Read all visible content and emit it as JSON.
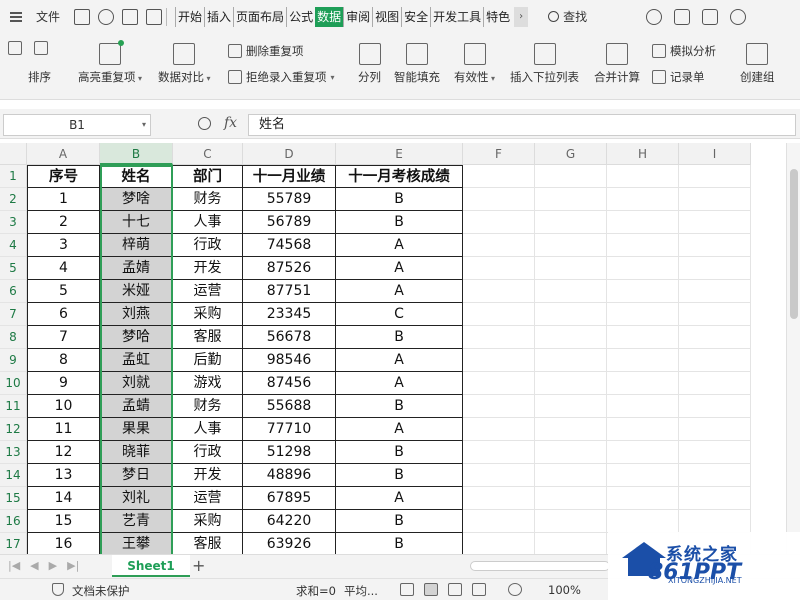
{
  "menubar": {
    "file_label": "文件",
    "tabs": [
      "开始",
      "插入",
      "页面布局",
      "公式",
      "数据",
      "审阅",
      "视图",
      "安全",
      "开发工具",
      "特色"
    ],
    "active_tab": "数据",
    "search_label": "查找"
  },
  "ribbon": {
    "sort": "排序",
    "highlight_dup": "高亮重复项",
    "data_compare": "数据对比",
    "remove_dup": "删除重复项",
    "reject_dup": "拒绝录入重复项",
    "split": "分列",
    "smart_fill": "智能填充",
    "validity": "有效性",
    "insert_dropdown": "插入下拉列表",
    "merge_calc": "合并计算",
    "simulate": "模拟分析",
    "record": "记录单",
    "create_group": "创建组"
  },
  "formula": {
    "cell_ref": "B1",
    "fx": "fx",
    "content": "姓名"
  },
  "grid": {
    "columns": [
      "A",
      "B",
      "C",
      "D",
      "E",
      "F",
      "G",
      "H",
      "I"
    ],
    "row_numbers": [
      "1",
      "2",
      "3",
      "4",
      "5",
      "6",
      "7",
      "8",
      "9",
      "10",
      "11",
      "12",
      "13",
      "14",
      "15",
      "16",
      "17"
    ],
    "header": [
      "序号",
      "姓名",
      "部门",
      "十一月业绩",
      "十一月考核成绩"
    ],
    "rows": [
      [
        "1",
        "梦啥",
        "财务",
        "55789",
        "B"
      ],
      [
        "2",
        "十七",
        "人事",
        "56789",
        "B"
      ],
      [
        "3",
        "梓萌",
        "行政",
        "74568",
        "A"
      ],
      [
        "4",
        "孟婧",
        "开发",
        "87526",
        "A"
      ],
      [
        "5",
        "米娅",
        "运营",
        "87751",
        "A"
      ],
      [
        "6",
        "刘燕",
        "采购",
        "23345",
        "C"
      ],
      [
        "7",
        "梦哈",
        "客服",
        "56678",
        "B"
      ],
      [
        "8",
        "孟虹",
        "后勤",
        "98546",
        "A"
      ],
      [
        "9",
        "刘就",
        "游戏",
        "87456",
        "A"
      ],
      [
        "10",
        "孟蜻",
        "财务",
        "55688",
        "B"
      ],
      [
        "11",
        "果果",
        "人事",
        "77710",
        "A"
      ],
      [
        "12",
        "晓菲",
        "行政",
        "51298",
        "B"
      ],
      [
        "13",
        "梦日",
        "开发",
        "48896",
        "B"
      ],
      [
        "14",
        "刘礼",
        "运营",
        "67895",
        "A"
      ],
      [
        "15",
        "艺青",
        "采购",
        "64220",
        "B"
      ],
      [
        "16",
        "王攀",
        "客服",
        "63926",
        "B"
      ]
    ]
  },
  "sheets": {
    "active": "Sheet1",
    "add": "+"
  },
  "status": {
    "doc_status": "文档未保护",
    "sum": "求和=0",
    "avg": "平均...",
    "zoom": "100%"
  },
  "watermark": {
    "brand": "系统之家",
    "brand2": "861PPT",
    "url": "XITONGZHIJIA.NET"
  }
}
